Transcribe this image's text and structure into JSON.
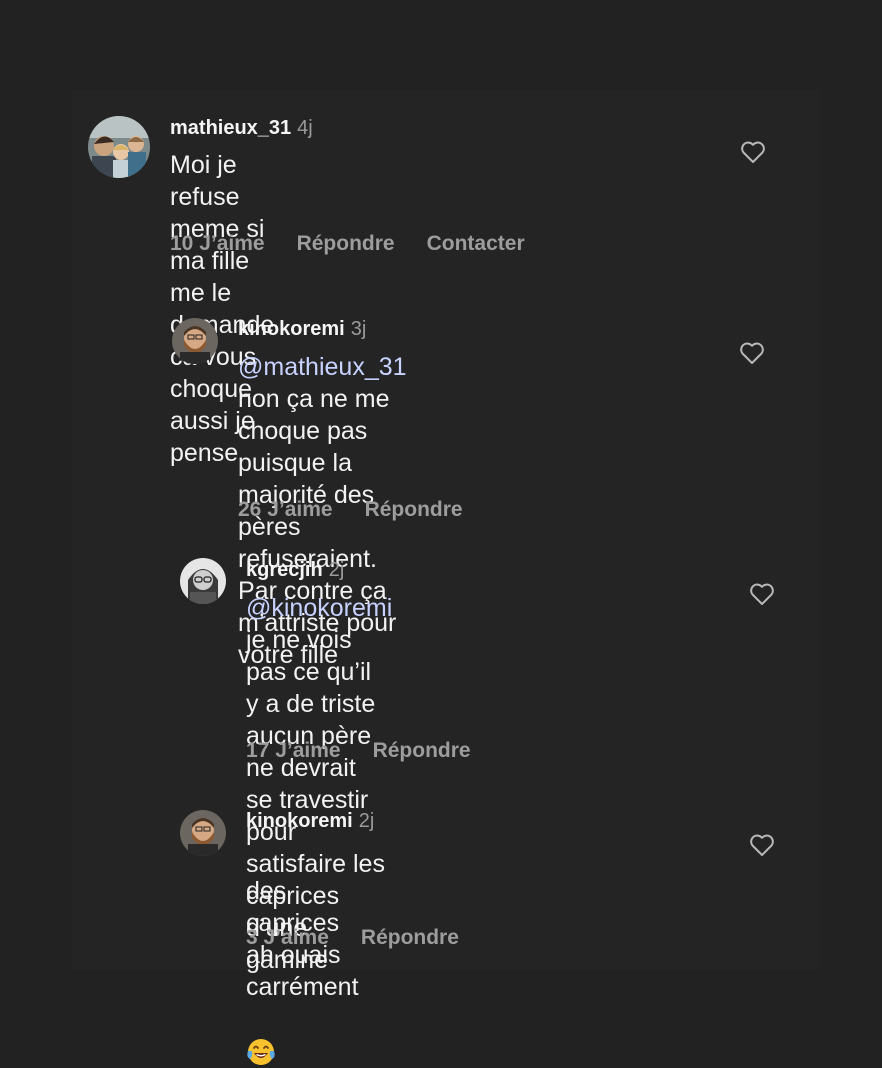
{
  "comments": [
    {
      "username": "mathieux_31",
      "time": "4j",
      "text": "Moi je refuse meme si ma fille me  le\ndemande ca vous choque aussi  je pense",
      "likes": "10 J’aime",
      "reply": "Répondre",
      "contact": "Contacter",
      "avatar_icon": "family-photo-avatar"
    },
    {
      "username": "kinokoremi",
      "time": "3j",
      "mention": "@mathieux_31",
      "text": " non ça ne me\nchoque pas puisque la majorité des\npères refuseraient. Par contre ça\nm’attriste pour votre fille",
      "likes": "26 J’aime",
      "reply": "Répondre",
      "avatar_icon": "bearded-man-avatar"
    },
    {
      "username": "kgrecjih",
      "time": "2j",
      "mention": "@kinokoremi",
      "text": " je ne vois pas ce qu’il\ny a de triste aucun père ne devrait\nse travestir pour satisfaire les\ncaprices d’une gamine",
      "likes": "17 J’aime",
      "reply": "Répondre",
      "avatar_icon": "woman-glasses-avatar"
    },
    {
      "username": "kinokoremi",
      "time": "2j",
      "text": "des caprices ah ouais carrément",
      "emoji": "face-with-tears-of-joy-emoji",
      "likes": "3 J’aime",
      "reply": "Répondre",
      "avatar_icon": "bearded-man-avatar"
    }
  ],
  "colors": {
    "background": "#222222",
    "text": "#f2f2f2",
    "muted": "#9d9d9d",
    "mention": "#c7d2ff"
  }
}
